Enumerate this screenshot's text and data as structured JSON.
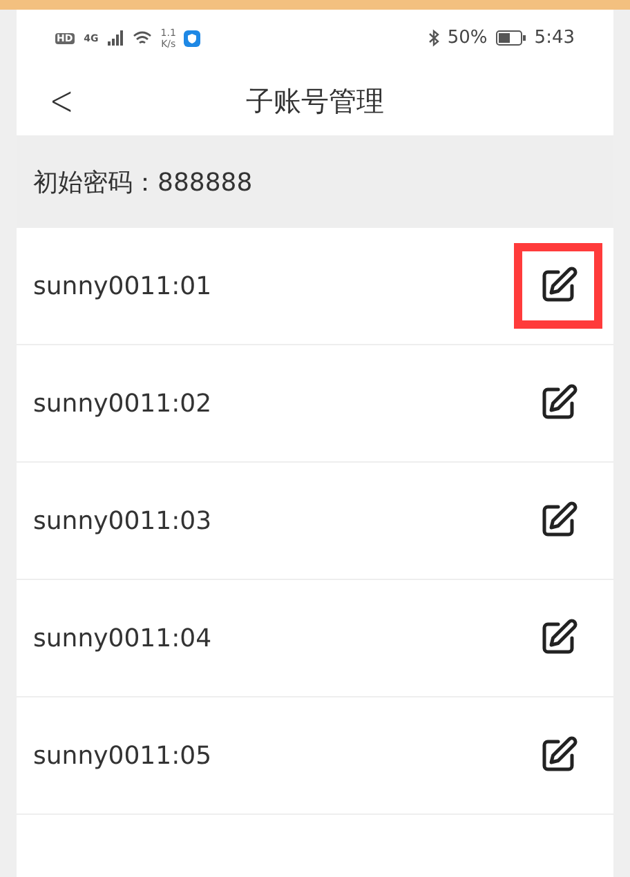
{
  "status_bar": {
    "left_badges": [
      "HD",
      "4G"
    ],
    "speed": [
      "1.1",
      "K/s"
    ],
    "battery": "50%",
    "time": "5:43"
  },
  "header": {
    "back": "<",
    "title": "子账号管理"
  },
  "notice": "初始密码：888888",
  "accounts": [
    {
      "name": "sunny0011:01",
      "highlighted": true
    },
    {
      "name": "sunny0011:02",
      "highlighted": false
    },
    {
      "name": "sunny0011:03",
      "highlighted": false
    },
    {
      "name": "sunny0011:04",
      "highlighted": false
    },
    {
      "name": "sunny0011:05",
      "highlighted": false
    }
  ]
}
